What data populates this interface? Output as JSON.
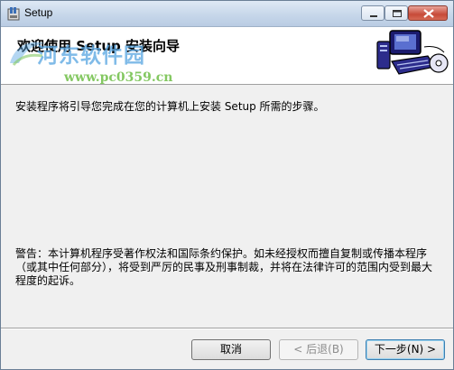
{
  "window": {
    "title": "Setup",
    "controls": {
      "minimize": "minimize-icon",
      "maximize": "maximize-icon",
      "close": "close-icon"
    }
  },
  "header": {
    "title": "欢迎使用 Setup 安装向导"
  },
  "watermark": {
    "brand": "河东软件园",
    "url": "www.pc0359.cn"
  },
  "body": {
    "intro": "安装程序将引导您完成在您的计算机上安装 Setup 所需的步骤。",
    "warning": "警告：本计算机程序受著作权法和国际条约保护。如未经授权而擅自复制或传播本程序（或其中任何部分），将受到严厉的民事及刑事制裁，并将在法律许可的范围内受到最大程度的起诉。"
  },
  "buttons": {
    "cancel": "取消",
    "back": "< 后退(B)",
    "next": "下一步(N) >"
  },
  "colors": {
    "titlebar": "#c7d7ea",
    "close_button": "#c74a38",
    "watermark_blue": "#5ca8e2",
    "watermark_green": "#6ebe46"
  }
}
